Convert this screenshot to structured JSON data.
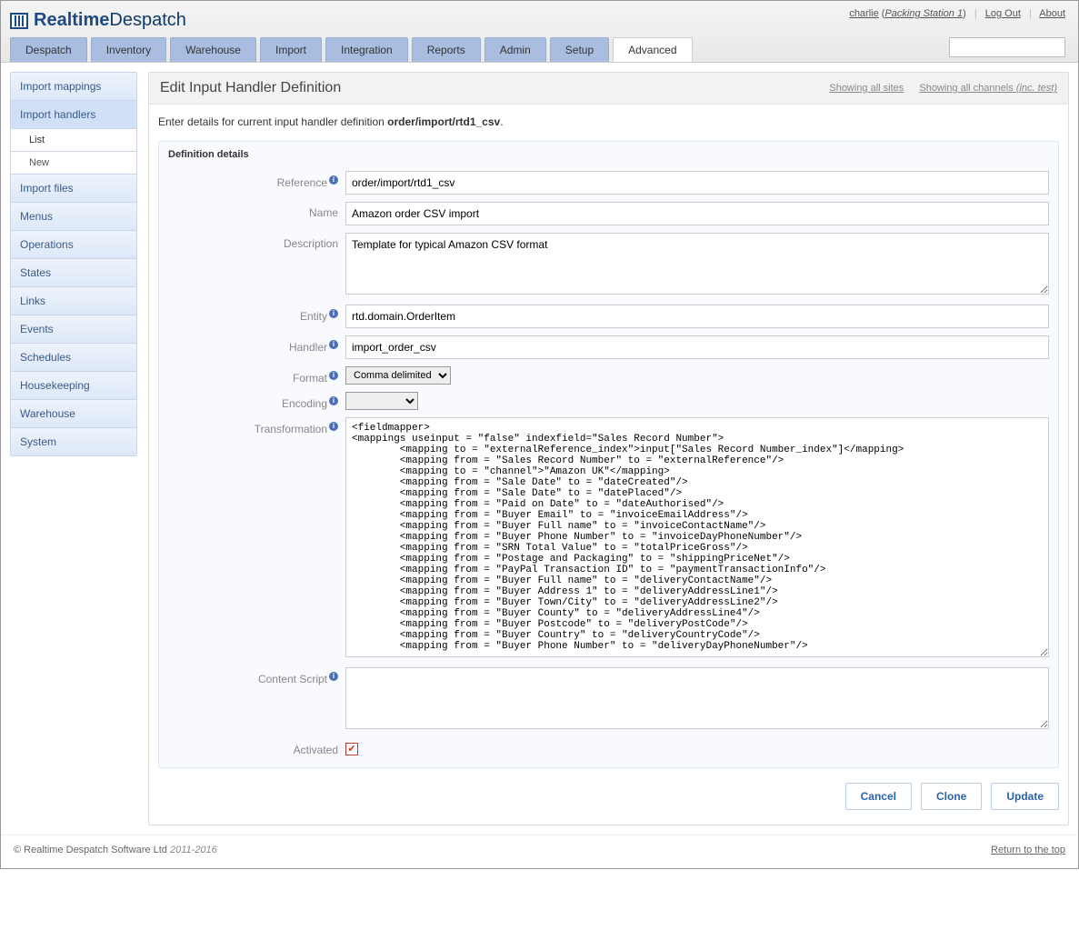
{
  "brand": {
    "name": "Realtime",
    "name2": "Despatch"
  },
  "user": {
    "name": "charlie",
    "station": "Packing Station 1"
  },
  "top_links": {
    "logout": "Log Out",
    "about": "About"
  },
  "nav": [
    {
      "label": "Despatch"
    },
    {
      "label": "Inventory"
    },
    {
      "label": "Warehouse"
    },
    {
      "label": "Import"
    },
    {
      "label": "Integration"
    },
    {
      "label": "Reports"
    },
    {
      "label": "Admin"
    },
    {
      "label": "Setup"
    },
    {
      "label": "Advanced",
      "active": true
    }
  ],
  "sidebar": [
    {
      "label": "Import mappings"
    },
    {
      "label": "Import handlers",
      "selected": true,
      "subs": [
        {
          "label": "List",
          "active": true
        },
        {
          "label": "New"
        }
      ]
    },
    {
      "label": "Import files"
    },
    {
      "label": "Menus"
    },
    {
      "label": "Operations"
    },
    {
      "label": "States"
    },
    {
      "label": "Links"
    },
    {
      "label": "Events"
    },
    {
      "label": "Schedules"
    },
    {
      "label": "Housekeeping"
    },
    {
      "label": "Warehouse"
    },
    {
      "label": "System"
    }
  ],
  "page": {
    "title": "Edit Input Handler Definition",
    "show_sites": "Showing all sites",
    "show_channels_pre": "Showing all channels ",
    "show_channels_em": "(inc. test)",
    "instruction_pre": "Enter details for current input handler definition ",
    "instruction_bold": "order/import/rtd1_csv",
    "instruction_post": "."
  },
  "panel_title": "Definition details",
  "labels": {
    "reference": "Reference",
    "name": "Name",
    "description": "Description",
    "entity": "Entity",
    "handler": "Handler",
    "format": "Format",
    "encoding": "Encoding",
    "transformation": "Transformation",
    "content_script": "Content Script",
    "activated": "Activated"
  },
  "values": {
    "reference": "order/import/rtd1_csv",
    "name": "Amazon order CSV import",
    "description": "Template for typical Amazon CSV format",
    "entity": "rtd.domain.OrderItem",
    "handler": "import_order_csv",
    "format_selected": "Comma delimited",
    "encoding_selected": "",
    "transformation": "<fieldmapper>\n<mappings useinput = \"false\" indexfield=\"Sales Record Number\">\n        <mapping to = \"externalReference_index\">input[\"Sales Record Number_index\"]</mapping>\n        <mapping from = \"Sales Record Number\" to = \"externalReference\"/>\n        <mapping to = \"channel\">\"Amazon UK\"</mapping>\n        <mapping from = \"Sale Date\" to = \"dateCreated\"/>\n        <mapping from = \"Sale Date\" to = \"datePlaced\"/>\n        <mapping from = \"Paid on Date\" to = \"dateAuthorised\"/>\n        <mapping from = \"Buyer Email\" to = \"invoiceEmailAddress\"/>\n        <mapping from = \"Buyer Full name\" to = \"invoiceContactName\"/>\n        <mapping from = \"Buyer Phone Number\" to = \"invoiceDayPhoneNumber\"/>\n        <mapping from = \"SRN Total Value\" to = \"totalPriceGross\"/>\n        <mapping from = \"Postage and Packaging\" to = \"shippingPriceNet\"/>\n        <mapping from = \"PayPal Transaction ID\" to = \"paymentTransactionInfo\"/>\n        <mapping from = \"Buyer Full name\" to = \"deliveryContactName\"/>\n        <mapping from = \"Buyer Address 1\" to = \"deliveryAddressLine1\"/>\n        <mapping from = \"Buyer Town/City\" to = \"deliveryAddressLine2\"/>\n        <mapping from = \"Buyer County\" to = \"deliveryAddressLine4\"/>\n        <mapping from = \"Buyer Postcode\" to = \"deliveryPostCode\"/>\n        <mapping from = \"Buyer Country\" to = \"deliveryCountryCode\"/>\n        <mapping from = \"Buyer Phone Number\" to = \"deliveryDayPhoneNumber\"/>",
    "content_script": "",
    "activated": true
  },
  "buttons": {
    "cancel": "Cancel",
    "clone": "Clone",
    "update": "Update"
  },
  "footer": {
    "copyright": "© Realtime Despatch Software Ltd ",
    "years": "2011-2016",
    "return_top": "Return to the top"
  }
}
